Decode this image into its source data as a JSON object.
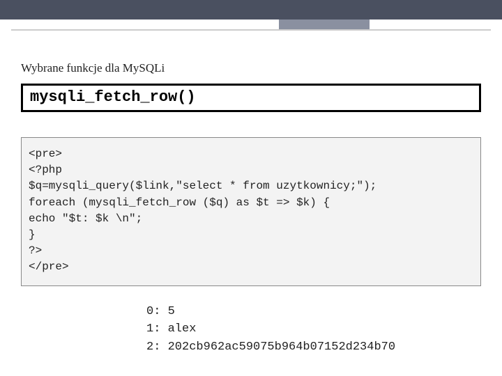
{
  "header": {
    "section_label": "Wybrane funkcje dla MySQLi",
    "function_name": "mysqli_fetch_row()"
  },
  "code_block": "<pre>\n<?php\n$q=mysqli_query($link,\"select * from uzytkownicy;\");\nforeach (mysqli_fetch_row ($q) as $t => $k) {\necho \"$t: $k \\n\";\n}\n?>\n</pre>",
  "output_lines": [
    "0: 5",
    "1: alex",
    "2: 202cb962ac59075b964b07152d234b70"
  ]
}
